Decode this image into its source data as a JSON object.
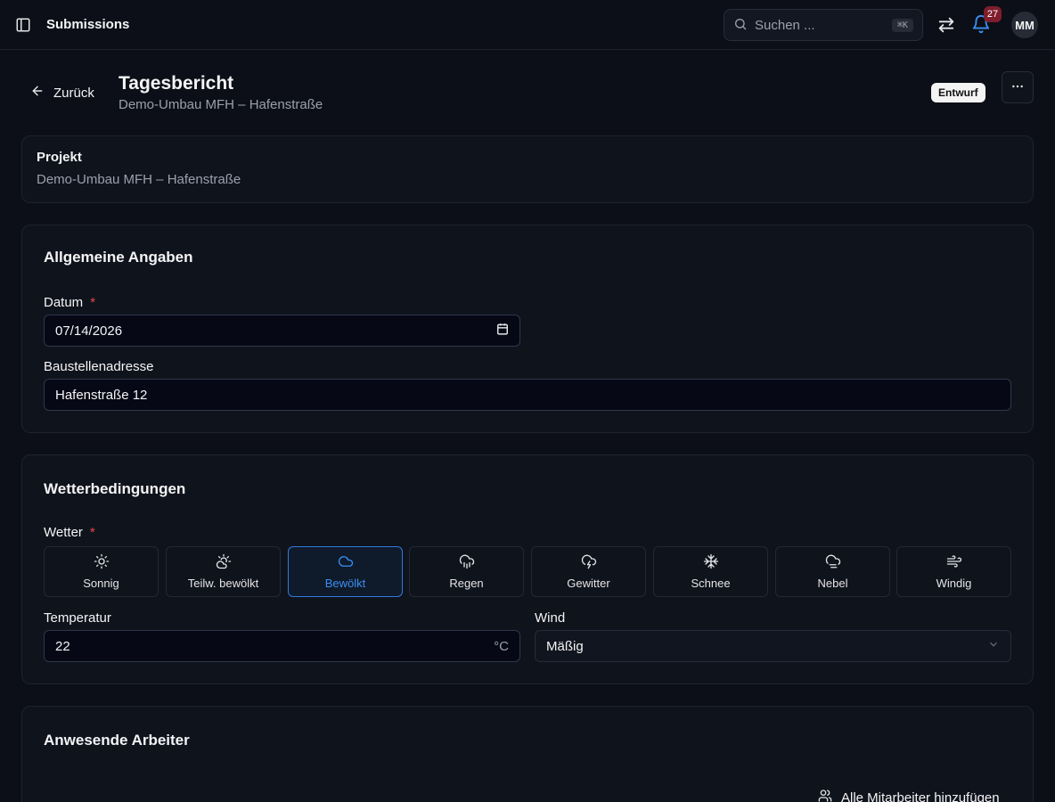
{
  "topbar": {
    "title": "Submissions",
    "search_placeholder": "Suchen ...",
    "search_shortcut": "⌘K",
    "notification_count": "27",
    "avatar_initials": "MM"
  },
  "header": {
    "back_label": "Zurück",
    "title": "Tagesbericht",
    "subtitle": "Demo-Umbau MFH – Hafenstraße",
    "status": "Entwurf"
  },
  "project": {
    "label": "Projekt",
    "value": "Demo-Umbau MFH – Hafenstraße"
  },
  "general": {
    "title": "Allgemeine Angaben",
    "date_label": "Datum",
    "date_required": "*",
    "date_value": "07/14/2026",
    "address_label": "Baustellenadresse",
    "address_value": "Hafenstraße 12"
  },
  "weather": {
    "title": "Wetterbedingungen",
    "label": "Wetter",
    "required": "*",
    "options": [
      {
        "label": "Sonnig",
        "icon": "sun-icon"
      },
      {
        "label": "Teilw. bewölkt",
        "icon": "cloud-sun-icon"
      },
      {
        "label": "Bewölkt",
        "icon": "cloud-icon",
        "selected": true
      },
      {
        "label": "Regen",
        "icon": "cloud-rain-icon"
      },
      {
        "label": "Gewitter",
        "icon": "cloud-lightning-icon"
      },
      {
        "label": "Schnee",
        "icon": "snowflake-icon"
      },
      {
        "label": "Nebel",
        "icon": "cloud-fog-icon"
      },
      {
        "label": "Windig",
        "icon": "wind-icon"
      }
    ],
    "temperature_label": "Temperatur",
    "temperature_value": "22",
    "temperature_unit": "°C",
    "wind_label": "Wind",
    "wind_value": "Mäßig"
  },
  "workers": {
    "title": "Anwesende Arbeiter",
    "add_all_label": "Alle Mitarbeiter hinzufügen"
  },
  "colors": {
    "background": "#0c0f17",
    "card": "#0f131c",
    "accent": "#3b8ef0",
    "required": "#e5484d",
    "badge": "#7f1d2d"
  }
}
